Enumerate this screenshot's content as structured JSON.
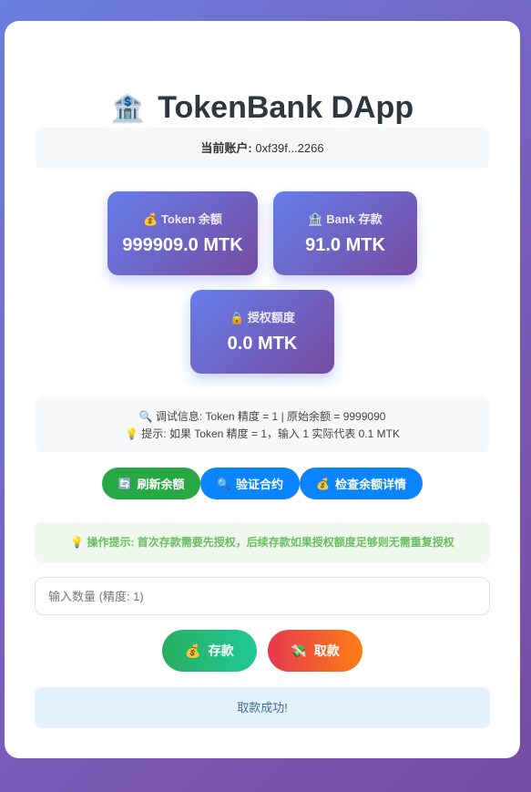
{
  "app": {
    "title_icon": "🏦",
    "title": "TokenBank DApp"
  },
  "account": {
    "label": "当前账户:",
    "address": "0xf39f...2266"
  },
  "stats": [
    {
      "icon": "💰",
      "label": "Token 余额",
      "value": "999909.0 MTK"
    },
    {
      "icon": "🏦",
      "label": "Bank 存款",
      "value": "91.0 MTK"
    },
    {
      "icon": "🔒",
      "label": "授权额度",
      "value": "0.0 MTK"
    }
  ],
  "debug": {
    "line1_icon": "🔍",
    "line1": "调试信息: Token 精度 = 1 | 原始余额 = 9999090",
    "line2_icon": "💡",
    "line2": "提示: 如果 Token 精度 = 1，输入 1 实际代表 0.1 MTK"
  },
  "buttons": {
    "refresh": {
      "icon": "🔄",
      "label": "刷新余额"
    },
    "verify": {
      "icon": "🔍",
      "label": "验证合约"
    },
    "detail": {
      "icon": "💰",
      "label": "检查余额详情"
    }
  },
  "tip": {
    "icon": "💡",
    "text": "操作提示: 首次存款需要先授权，后续存款如果授权额度足够则无需重复授权"
  },
  "amount_input": {
    "placeholder": "输入数量 (精度: 1)",
    "value": ""
  },
  "actions": {
    "deposit": {
      "icon": "💰",
      "label": "存款"
    },
    "withdraw": {
      "icon": "💸",
      "label": "取款"
    }
  },
  "status": {
    "message": "取款成功!"
  },
  "colors": {
    "page_bg_start": "#6a7fe0",
    "page_bg_end": "#764ba2",
    "stat_start": "#667eea",
    "stat_end": "#764ba2",
    "refresh": "#28a745",
    "primary": "#0a84ff",
    "tip_text": "#6abf62",
    "status_bg": "#e5f1fc"
  }
}
